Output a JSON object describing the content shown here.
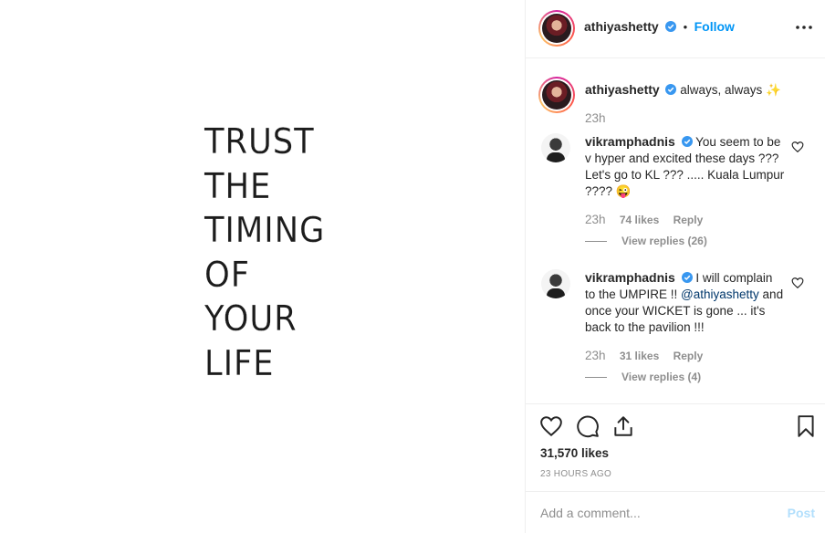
{
  "post": {
    "quote_lines": [
      "TRUST",
      "THE",
      "TIMING",
      "OF",
      "YOUR",
      "LIFE"
    ]
  },
  "header": {
    "username": "athiyashetty",
    "separator": "•",
    "follow_label": "Follow",
    "more_icon": "more-horizontal-icon"
  },
  "caption": {
    "username": "athiyashetty",
    "text": "always, always",
    "emoji": "✨",
    "time": "23h"
  },
  "comments": [
    {
      "username": "vikramphadnis",
      "text": "You seem to be v hyper and excited these days ??? Let's go to KL ??? ..... Kuala Lumpur ???? 😜",
      "time": "23h",
      "likes": "74 likes",
      "reply": "Reply",
      "view_replies": "View replies (26)"
    },
    {
      "username": "vikramphadnis",
      "text_before": "I will complain to the UMPIRE !! ",
      "mention": "@athiyashetty",
      "text_after": " and once your WICKET is gone ... it's back to the pavilion !!!",
      "time": "23h",
      "likes": "31 likes",
      "reply": "Reply",
      "view_replies": "View replies (4)"
    }
  ],
  "actions": {
    "likes": "31,570 likes",
    "posted": "23 HOURS AGO",
    "icons": [
      "heart-icon",
      "comment-icon",
      "share-icon",
      "bookmark-icon"
    ]
  },
  "add_comment": {
    "placeholder": "Add a comment...",
    "post_label": "Post"
  },
  "colors": {
    "accent": "#0095f6",
    "verified": "#3897f0",
    "muted": "#8e8e8e",
    "post_disabled": "#b2dffc"
  }
}
